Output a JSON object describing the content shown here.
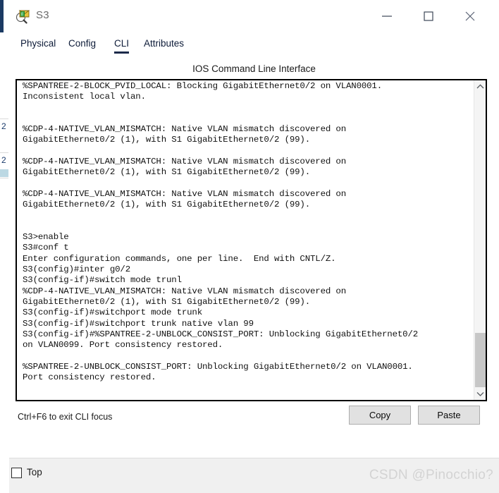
{
  "window": {
    "title": "S3",
    "icon": "packet-tracer-device-icon",
    "controls": {
      "minimize": "minimize-icon",
      "maximize": "maximize-icon",
      "close": "close-icon"
    }
  },
  "tabs": [
    {
      "label": "Physical",
      "active": false
    },
    {
      "label": "Config",
      "active": false
    },
    {
      "label": "CLI",
      "active": true
    },
    {
      "label": "Attributes",
      "active": false
    }
  ],
  "panel": {
    "title": "IOS Command Line Interface",
    "hint": "Ctrl+F6 to exit CLI focus",
    "copy_label": "Copy",
    "paste_label": "Paste"
  },
  "terminal": {
    "content": "%SPANTREE-2-BLOCK_PVID_LOCAL: Blocking GigabitEthernet0/2 on VLAN0001.\nInconsistent local vlan.\n\n\n%CDP-4-NATIVE_VLAN_MISMATCH: Native VLAN mismatch discovered on\nGigabitEthernet0/2 (1), with S1 GigabitEthernet0/2 (99).\n\n%CDP-4-NATIVE_VLAN_MISMATCH: Native VLAN mismatch discovered on\nGigabitEthernet0/2 (1), with S1 GigabitEthernet0/2 (99).\n\n%CDP-4-NATIVE_VLAN_MISMATCH: Native VLAN mismatch discovered on\nGigabitEthernet0/2 (1), with S1 GigabitEthernet0/2 (99).\n\n\nS3>enable\nS3#conf t\nEnter configuration commands, one per line.  End with CNTL/Z.\nS3(config)#inter g0/2\nS3(config-if)#switch mode trunl\n%CDP-4-NATIVE_VLAN_MISMATCH: Native VLAN mismatch discovered on\nGigabitEthernet0/2 (1), with S1 GigabitEthernet0/2 (99).\nS3(config-if)#switchport mode trunk\nS3(config-if)#switchport trunk native vlan 99\nS3(config-if)#%SPANTREE-2-UNBLOCK_CONSIST_PORT: Unblocking GigabitEthernet0/2\non VLAN0099. Port consistency restored.\n\n%SPANTREE-2-UNBLOCK_CONSIST_PORT: Unblocking GigabitEthernet0/2 on VLAN0001.\nPort consistency restored.\n",
    "scrollbar": {
      "up_icon": "chevron-up-icon",
      "down_icon": "chevron-down-icon",
      "thumb_top_pct": 79,
      "thumb_height_pct": 17
    }
  },
  "footer": {
    "top_checkbox_label": "Top",
    "top_checked": false,
    "watermark": "CSDN @Pinocchio?"
  },
  "colors": {
    "tab_active_underline": "#1c2a4a",
    "title_text": "#6b6b6b",
    "terminal_border": "#000000",
    "button_face": "#e1e1e1",
    "watermark": "#d3d3d3"
  },
  "backdrop": {
    "peek_digits": [
      "2",
      "2"
    ]
  }
}
